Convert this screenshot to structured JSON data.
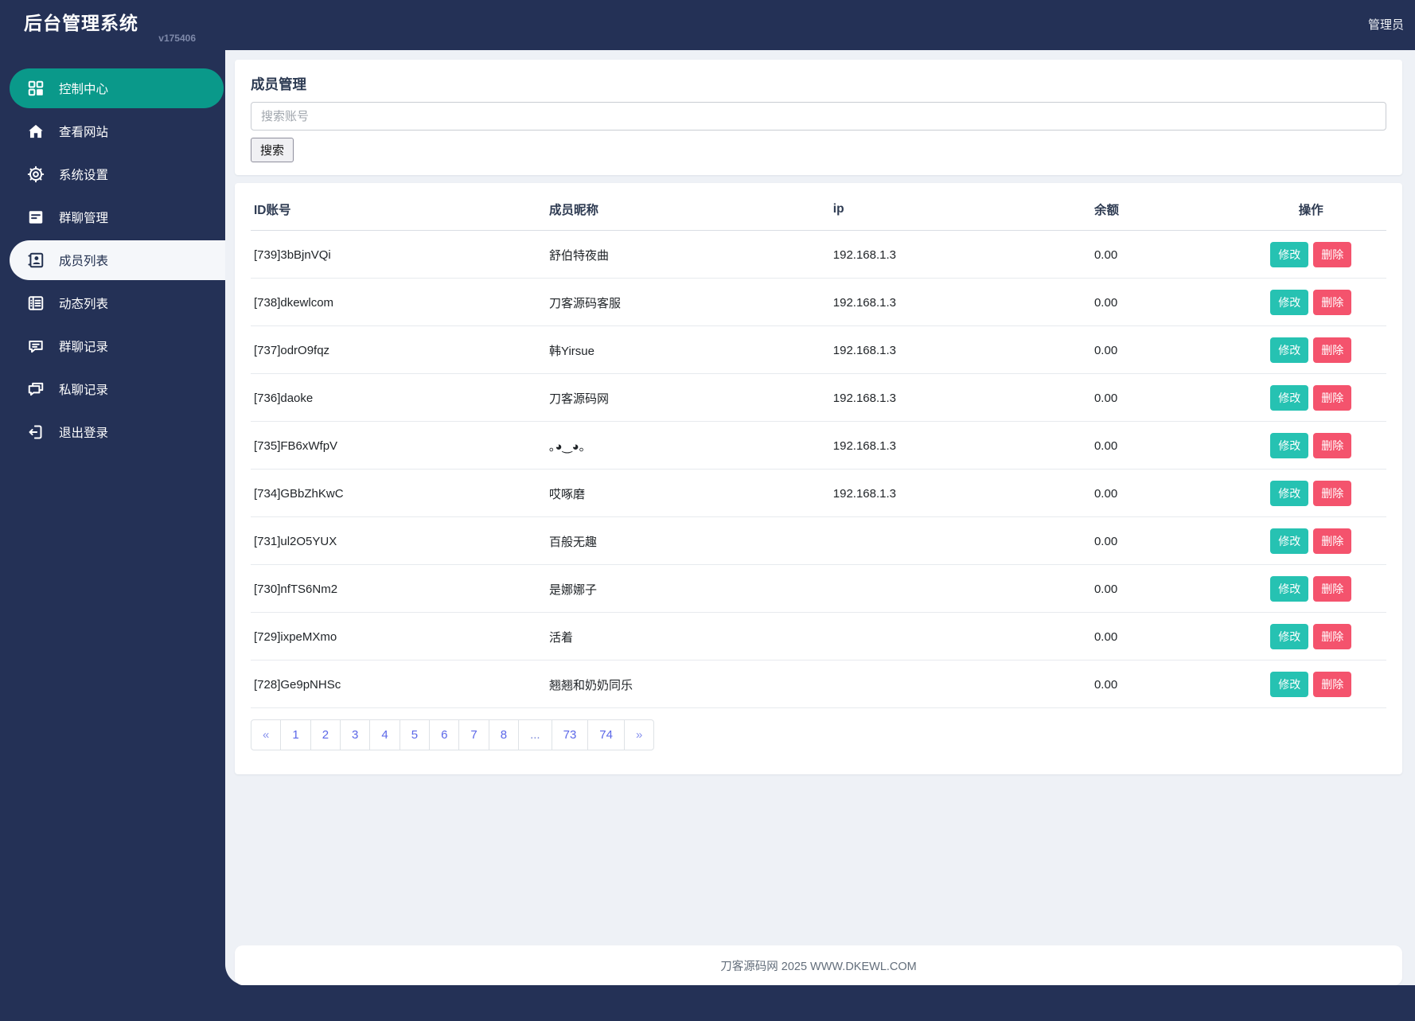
{
  "brand": {
    "title": "后台管理系统",
    "version": "v175406"
  },
  "topbar": {
    "user": "管理员"
  },
  "sidebar": {
    "items": [
      {
        "label": "控制中心",
        "icon": "grid-icon",
        "state": "active-teal"
      },
      {
        "label": "查看网站",
        "icon": "home-icon",
        "state": ""
      },
      {
        "label": "系统设置",
        "icon": "gear-icon",
        "state": ""
      },
      {
        "label": "群聊管理",
        "icon": "document-icon",
        "state": ""
      },
      {
        "label": "成员列表",
        "icon": "member-card-icon",
        "state": "current"
      },
      {
        "label": "动态列表",
        "icon": "list-icon",
        "state": ""
      },
      {
        "label": "群聊记录",
        "icon": "chat-lines-icon",
        "state": ""
      },
      {
        "label": "私聊记录",
        "icon": "chat-double-icon",
        "state": ""
      },
      {
        "label": "退出登录",
        "icon": "logout-icon",
        "state": ""
      }
    ]
  },
  "page": {
    "title": "成员管理",
    "search_placeholder": "搜索账号",
    "search_button": "搜索"
  },
  "table": {
    "columns": [
      "ID账号",
      "成员昵称",
      "ip",
      "余额",
      "操作"
    ],
    "actions": {
      "edit": "修改",
      "delete": "删除"
    },
    "rows": [
      {
        "id": "[739]3bBjnVQi",
        "nickname": "舒伯特夜曲",
        "ip": "192.168.1.3",
        "balance": "0.00"
      },
      {
        "id": "[738]dkewlcom",
        "nickname": "刀客源码客服",
        "ip": "192.168.1.3",
        "balance": "0.00"
      },
      {
        "id": "[737]odrO9fqz",
        "nickname": "韩Yirsue",
        "ip": "192.168.1.3",
        "balance": "0.00"
      },
      {
        "id": "[736]daoke",
        "nickname": "刀客源码网",
        "ip": "192.168.1.3",
        "balance": "0.00"
      },
      {
        "id": "[735]FB6xWfpV",
        "nickname": "｡◕‿◕｡",
        "ip": "192.168.1.3",
        "balance": "0.00"
      },
      {
        "id": "[734]GBbZhKwC",
        "nickname": "哎啄磨",
        "ip": "192.168.1.3",
        "balance": "0.00"
      },
      {
        "id": "[731]ul2O5YUX",
        "nickname": "百般无趣",
        "ip": "",
        "balance": "0.00"
      },
      {
        "id": "[730]nfTS6Nm2",
        "nickname": "是娜娜子",
        "ip": "",
        "balance": "0.00"
      },
      {
        "id": "[729]ixpeMXmo",
        "nickname": "活着",
        "ip": "",
        "balance": "0.00"
      },
      {
        "id": "[728]Ge9pNHSc",
        "nickname": "翘翘和奶奶同乐",
        "ip": "",
        "balance": "0.00"
      }
    ]
  },
  "pagination": {
    "items": [
      "«",
      "1",
      "2",
      "3",
      "4",
      "5",
      "6",
      "7",
      "8",
      "...",
      "73",
      "74",
      "»"
    ]
  },
  "footer": {
    "text": "刀客源码网 2025 WWW.DKEWL.COM"
  },
  "colors": {
    "navy": "#243156",
    "teal_active": "#0a998a",
    "teal_button": "#26c2b2",
    "red_button": "#f4536d",
    "pagination_blue": "#5b67e8",
    "content_bg": "#eef1f6"
  }
}
